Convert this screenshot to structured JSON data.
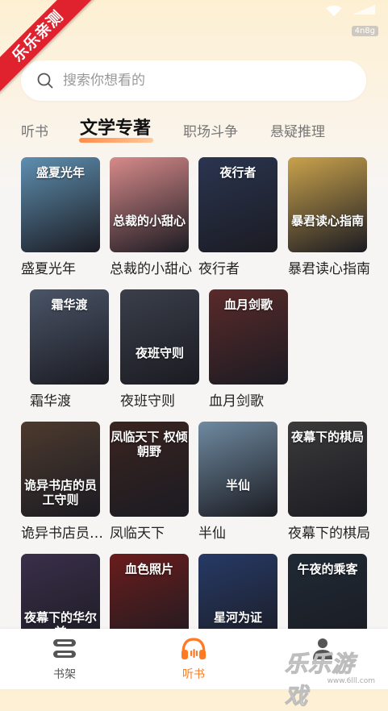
{
  "watermark_badge": "乐乐亲测",
  "status": {
    "net_speed": "4n8g"
  },
  "search": {
    "placeholder": "搜索你想看的"
  },
  "tabs": [
    {
      "label": "听书",
      "active": false
    },
    {
      "label": "文学专著",
      "active": true
    },
    {
      "label": "职场斗争",
      "active": false
    },
    {
      "label": "悬疑推理",
      "active": false
    }
  ],
  "books": [
    {
      "title": "盛夏光年",
      "cover_text": "盛夏光年",
      "color": "#5e8fb0"
    },
    {
      "title": "总裁的小甜心",
      "cover_text": "总裁的小甜心",
      "color": "#d78a8a"
    },
    {
      "title": "夜行者",
      "cover_text": "夜行者",
      "color": "#2a3550"
    },
    {
      "title": "暴君读心指南",
      "cover_text": "暴君读心指南",
      "color": "#c9a24c"
    },
    {
      "title": "霜华渡",
      "cover_text": "霜华渡",
      "color": "#4a5568"
    },
    {
      "title": "夜班守则",
      "cover_text": "夜班守则",
      "color": "#3a3f4a"
    },
    {
      "title": "血月剑歌",
      "cover_text": "血月剑歌",
      "color": "#5a2a2a"
    },
    {
      "title": "诡异书店员工守则",
      "cover_text": "诡异书店的员工守则",
      "color": "#4d3a2e"
    },
    {
      "title": "凤临天下",
      "cover_text": "凤临天下 权倾朝野",
      "color": "#3a2420"
    },
    {
      "title": "半仙",
      "cover_text": "半仙",
      "color": "#6f8aa0"
    },
    {
      "title": "夜幕下的棋局",
      "cover_text": "夜幕下的棋局",
      "color": "#3b3b3b"
    },
    {
      "title": "夜幕下的华尔兹",
      "cover_text": "夜幕下的华尔兹",
      "color": "#3a2f4a"
    },
    {
      "title": "血色照片",
      "cover_text": "血色照片",
      "color": "#6a1c1c"
    },
    {
      "title": "星河为证",
      "cover_text": "星河为证",
      "color": "#263a66"
    },
    {
      "title": "午夜的乘客",
      "cover_text": "午夜的乘客",
      "color": "#1f2a35"
    }
  ],
  "nav": {
    "bookshelf": "书架",
    "listen": "听书"
  },
  "watermark": {
    "text": "乐乐游戏",
    "url": "www.6lll.com"
  }
}
